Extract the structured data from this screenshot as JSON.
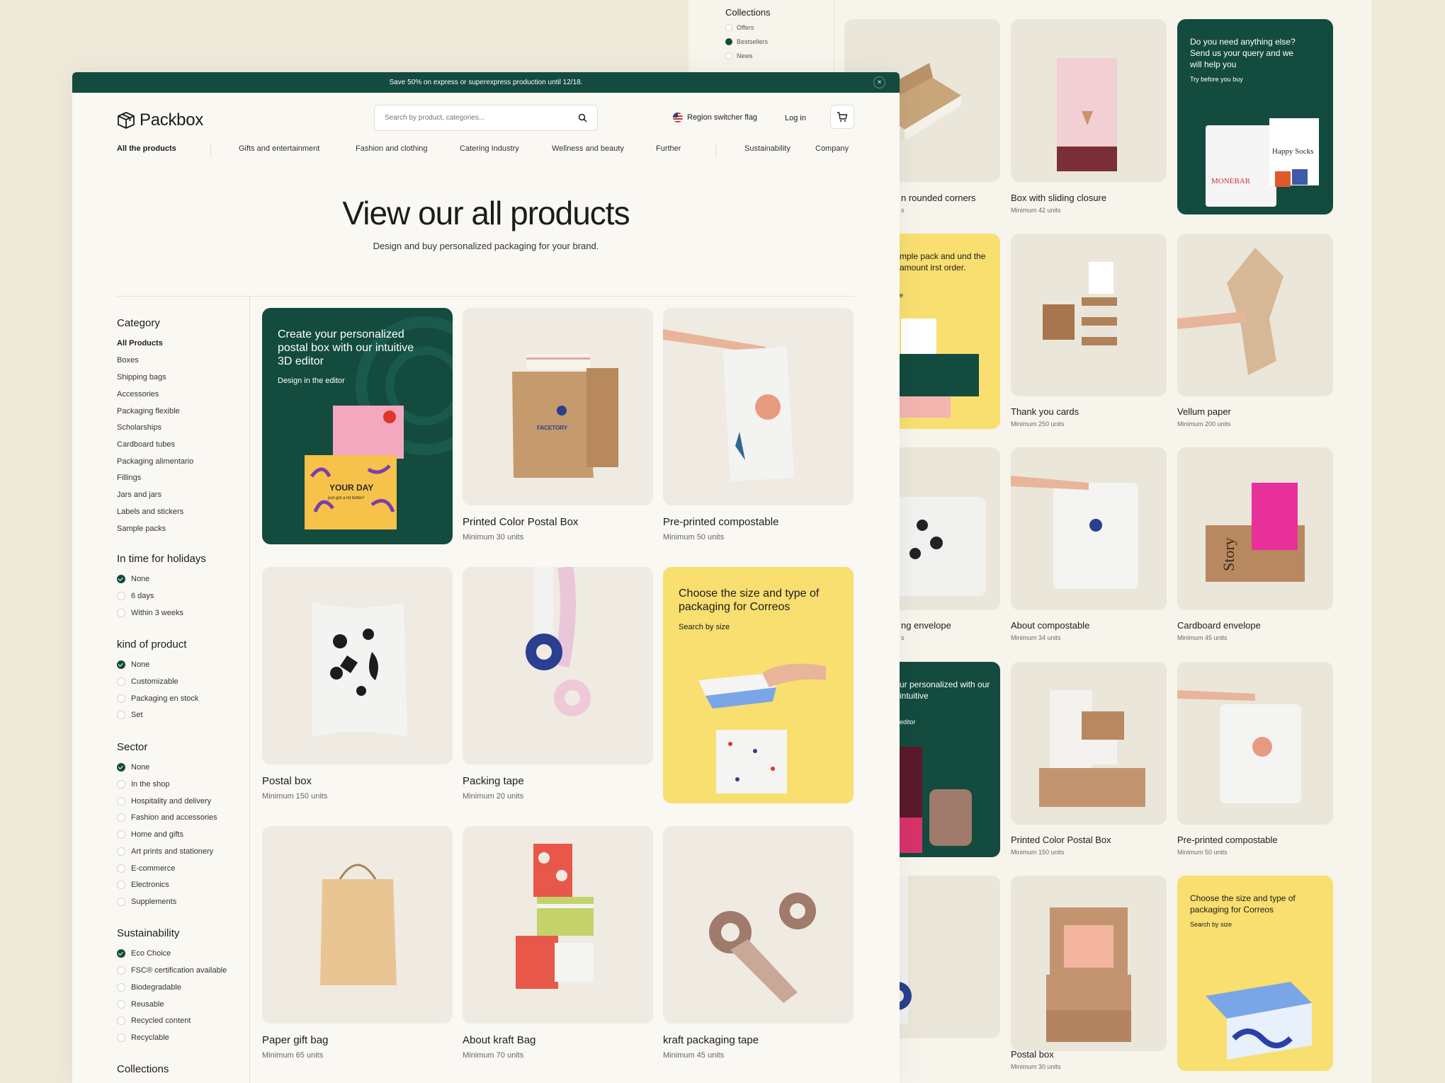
{
  "promo_bar": {
    "text": "Save 50% on express or superexpress production until 12/18.",
    "close": "×"
  },
  "header": {
    "logo": "Packbox",
    "search_placeholder": "Search by product, categories...",
    "region": "Region switcher flag",
    "login": "Log in"
  },
  "nav": {
    "items": [
      "All the products",
      "Gifts and entertainment",
      "Fashion and clothing",
      "Catering Industry",
      "Wellness and beauty",
      "Further",
      "Sustainability",
      "Company"
    ]
  },
  "hero": {
    "title": "View our all products",
    "subtitle": "Design and buy personalized packaging for your brand."
  },
  "sidebar": {
    "category": {
      "title": "Category",
      "items": [
        "All Products",
        "Boxes",
        "Shipping bags",
        "Accessories",
        "Packaging flexible",
        "Scholarships",
        "Cardboard tubes",
        "Packaging alimentario",
        "Fillings",
        "Jars and jars",
        "Labels and stickers",
        "Sample packs"
      ]
    },
    "holidays": {
      "title": "In time for holidays",
      "items": [
        "None",
        "6 days",
        "Within 3 weeks"
      ]
    },
    "kind": {
      "title": "kind of product",
      "items": [
        "None",
        "Customizable",
        "Packaging en stock",
        "Set"
      ]
    },
    "sector": {
      "title": "Sector",
      "items": [
        "None",
        "In the shop",
        "Hospitality and delivery",
        "Fashion and accessories",
        "Home and gifts",
        "Art prints and stationery",
        "E-commerce",
        "Electronics",
        "Supplements"
      ]
    },
    "sustainability": {
      "title": "Sustainability",
      "items": [
        "Eco Choice",
        "FSC® certification available",
        "Biodegradable",
        "Reusable",
        "Recycled content",
        "Recyclable"
      ]
    },
    "collections": {
      "title": "Collections"
    }
  },
  "grid": {
    "promo_editor": {
      "title": "Create your personalized postal box with our intuitive 3D editor",
      "link": "Design in the editor",
      "box_text": "YOUR DAY",
      "box_sub": "just got a lot better!"
    },
    "promo_size": {
      "title": "Choose the size and type of packaging for Correos",
      "link": "Search by size"
    },
    "products": [
      {
        "name": "Printed Color Postal Box",
        "min": "Minimum 30 units"
      },
      {
        "name": "Pre-printed compostable",
        "min": "Minimum 50 units"
      },
      {
        "name": "Postal box",
        "min": "Minimum 150 units"
      },
      {
        "name": "Packing tape",
        "min": "Minimum 20 units"
      },
      {
        "name": "Paper gift bag",
        "min": "Minimum 65 units"
      },
      {
        "name": "About kraft Bag",
        "min": "Minimum 70 units"
      },
      {
        "name": "kraft packaging tape",
        "min": "Minimum 45 units"
      }
    ]
  },
  "background_page": {
    "collections": {
      "title": "Collections",
      "items": [
        "Offers",
        "Bestsellers",
        "News"
      ]
    },
    "promo_query": {
      "title": "Do you need anything else? Send us your query and we will help you",
      "link": "Try before you buy"
    },
    "promo_sample": {
      "title": "mple pack and und the amount irst order.",
      "link": "e"
    },
    "promo_editor": {
      "title": "ur personalized with our intuitive",
      "link": "editor"
    },
    "promo_size": {
      "title": "Choose the size and type of packaging for Correos",
      "link": "Search by size"
    },
    "products": [
      {
        "name": "n rounded corners",
        "min": "s"
      },
      {
        "name": "Box with sliding closure",
        "min": "Minimum 42 units"
      },
      {
        "name": "Thank you cards",
        "min": "Minimum 250 units"
      },
      {
        "name": "Vellum paper",
        "min": "Minimum 200 units"
      },
      {
        "name": "ng envelope",
        "min": "s"
      },
      {
        "name": "About compostable",
        "min": "Minimum 34 units"
      },
      {
        "name": "Cardboard envelope",
        "min": "Minimum 45 units"
      },
      {
        "name": "Printed Color Postal Box",
        "min": "Minimum 150 units"
      },
      {
        "name": "Pre-printed compostable",
        "min": "Minimum 50 units"
      },
      {
        "name": "Postal box",
        "min": "Minimum 30 units"
      }
    ],
    "brand_labels": [
      "MONEBAR",
      "Happy Socks",
      "Story"
    ]
  },
  "colors": {
    "accent": "#134b3f",
    "yellow": "#f8df70",
    "bg": "#faf8f2"
  }
}
